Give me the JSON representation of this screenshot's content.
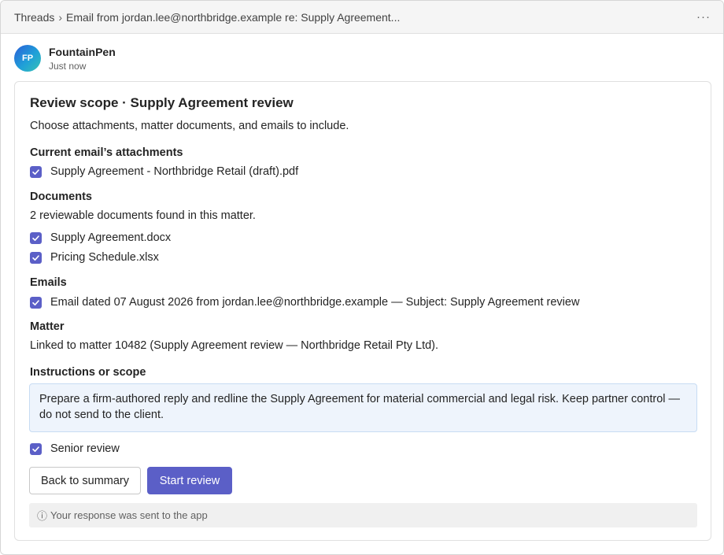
{
  "topbar": {
    "breadcrumb_root": "Threads",
    "breadcrumb_separator": "›",
    "breadcrumb_current": "Email from jordan.lee@northbridge.example re: Supply Agreement...",
    "more_icon": "more-horizontal-icon",
    "more_glyph": "···"
  },
  "sender": {
    "initials": "FP",
    "name": "FountainPen",
    "time": "Just now"
  },
  "card": {
    "title": "Review scope · Supply Agreement review",
    "intro": "Choose attachments, matter documents, and emails to include.",
    "attachments": {
      "heading": "Current email’s attachments",
      "items": [
        {
          "label": "Supply Agreement - Northbridge Retail (draft).pdf",
          "checked": true
        }
      ]
    },
    "documents": {
      "heading": "Documents",
      "note": "2 reviewable documents found in this matter.",
      "items": [
        {
          "label": "Supply Agreement.docx",
          "checked": true
        },
        {
          "label": "Pricing Schedule.xlsx",
          "checked": true
        }
      ]
    },
    "emails": {
      "heading": "Emails",
      "items": [
        {
          "label": "Email dated 07 August 2026 from jordan.lee@northbridge.example — Subject: Supply Agreement review",
          "checked": true
        }
      ]
    },
    "matter": {
      "heading": "Matter",
      "text": "Linked to matter 10482 (Supply Agreement review — Northbridge Retail Pty Ltd)."
    },
    "instructions": {
      "heading": "Instructions or scope",
      "value": "Prepare a firm-authored reply and redline the Supply Agreement for material commercial and legal risk. Keep partner control — do not send to the client."
    },
    "senior_review": {
      "label": "Senior review",
      "checked": true
    },
    "buttons": {
      "back_label": "Back to summary",
      "start_label": "Start review"
    },
    "notice": {
      "icon": "info-icon",
      "glyph": "ⓘ",
      "text": "Your response was sent to the app"
    }
  },
  "colors": {
    "accent": "#5b5fc7",
    "instructions_bg": "#eef4fc",
    "instructions_border": "#c7dcf3",
    "notice_bg": "#f0f0f0"
  }
}
